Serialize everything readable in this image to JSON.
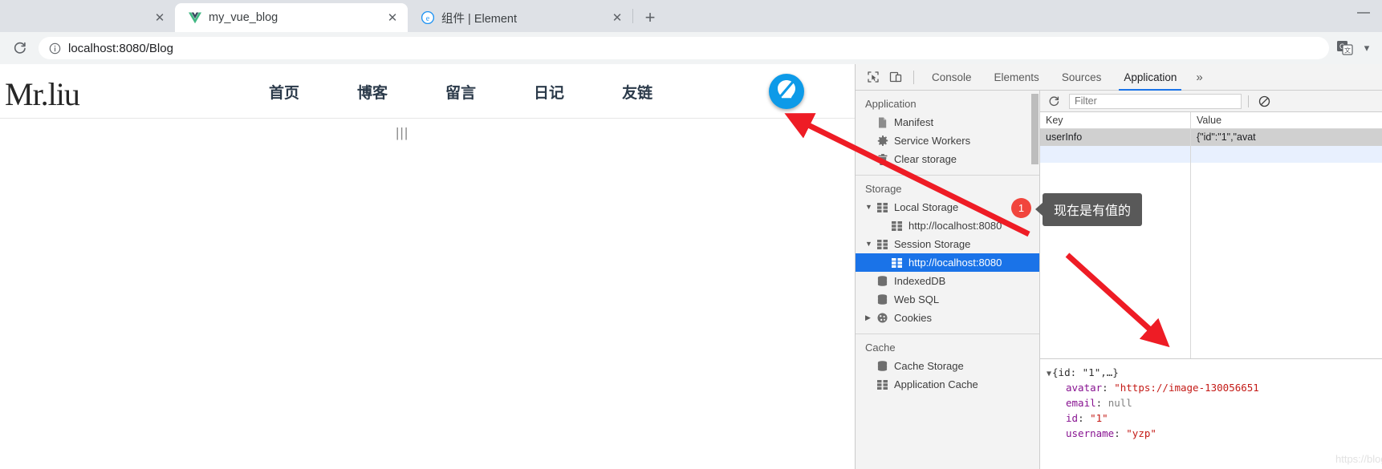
{
  "browser": {
    "tabs": [
      {
        "title": "",
        "favicon": "none",
        "state": "partial"
      },
      {
        "title": "my_vue_blog",
        "favicon": "vue-icon",
        "state": "active"
      },
      {
        "title": "组件 | Element",
        "favicon": "element-icon",
        "state": "inactive"
      }
    ],
    "new_tab_label": "+",
    "close_label": "✕",
    "window_controls": {
      "minimize": "—"
    },
    "toolbar": {
      "reload_icon": "reload-icon",
      "site_info_icon": "info-icon",
      "url_scheme": "",
      "url": "localhost:8080/Blog",
      "url_host": "localhost:8080",
      "url_path": "/Blog",
      "translate_icon": "translate-icon",
      "overflow_icon": "chevron-down-icon"
    }
  },
  "page": {
    "brand": "Mr.liu",
    "nav": [
      {
        "label": "首页"
      },
      {
        "label": "博客"
      },
      {
        "label": "留言"
      },
      {
        "label": "日记"
      },
      {
        "label": "友链"
      }
    ],
    "avatar_icon": "lightbulb-avatar-icon",
    "drag_handle": "|||"
  },
  "devtools": {
    "tabs": [
      {
        "label": "Console",
        "active": false
      },
      {
        "label": "Elements",
        "active": false
      },
      {
        "label": "Sources",
        "active": false
      },
      {
        "label": "Application",
        "active": true
      }
    ],
    "more_label": "»",
    "inspect_icon": "inspect-cursor-icon",
    "device_icon": "device-toolbar-icon",
    "sidebar": {
      "sections": [
        {
          "title": "Application",
          "items": [
            {
              "label": "Manifest",
              "icon": "manifest-file-icon",
              "indent": 1,
              "twisty": "",
              "selected": false
            },
            {
              "label": "Service Workers",
              "icon": "gear-icon",
              "indent": 1,
              "twisty": "",
              "selected": false
            },
            {
              "label": "Clear storage",
              "icon": "trash-icon",
              "indent": 1,
              "twisty": "",
              "selected": false
            }
          ]
        },
        {
          "title": "Storage",
          "items": [
            {
              "label": "Local Storage",
              "icon": "storage-table-icon",
              "indent": 1,
              "twisty": "▼",
              "selected": false
            },
            {
              "label": "http://localhost:8080",
              "icon": "storage-table-icon",
              "indent": 2,
              "twisty": "",
              "selected": false
            },
            {
              "label": "Session Storage",
              "icon": "storage-table-icon",
              "indent": 1,
              "twisty": "▼",
              "selected": false
            },
            {
              "label": "http://localhost:8080",
              "icon": "storage-table-icon",
              "indent": 2,
              "twisty": "",
              "selected": true
            },
            {
              "label": "IndexedDB",
              "icon": "database-icon",
              "indent": 1,
              "twisty": "",
              "selected": false
            },
            {
              "label": "Web SQL",
              "icon": "database-icon",
              "indent": 1,
              "twisty": "",
              "selected": false
            },
            {
              "label": "Cookies",
              "icon": "cookie-icon",
              "indent": 1,
              "twisty": "▶",
              "selected": false
            }
          ]
        },
        {
          "title": "Cache",
          "items": [
            {
              "label": "Cache Storage",
              "icon": "database-icon",
              "indent": 1,
              "twisty": "",
              "selected": false
            },
            {
              "label": "Application Cache",
              "icon": "storage-table-icon",
              "indent": 1,
              "twisty": "",
              "selected": false
            }
          ]
        }
      ]
    },
    "filter": {
      "refresh_icon": "refresh-icon",
      "placeholder": "Filter",
      "value": "",
      "clear_icon": "clear-prohibited-icon"
    },
    "table": {
      "columns": [
        "Key",
        "Value"
      ],
      "rows": [
        {
          "key": "userInfo",
          "value": "{\"id\":\"1\",\"avat",
          "selected": true
        }
      ]
    },
    "preview": {
      "root": "{id: \"1\",…}",
      "twisty": "▼",
      "entries": [
        {
          "key": "avatar",
          "value": "\"https://image-130056651",
          "type": "string"
        },
        {
          "key": "email",
          "value": "null",
          "type": "null"
        },
        {
          "key": "id",
          "value": "\"1\"",
          "type": "string"
        },
        {
          "key": "username",
          "value": "\"yzp\"",
          "type": "string"
        }
      ],
      "watermark": "https://blog.csdn.net/grd_java"
    }
  },
  "annotations": {
    "badge_number": "1",
    "tooltip_text": "现在是有值的",
    "accent_red": "#f1453d",
    "tooltip_bg": "#595959",
    "arrow_color": "#ee1c25"
  }
}
